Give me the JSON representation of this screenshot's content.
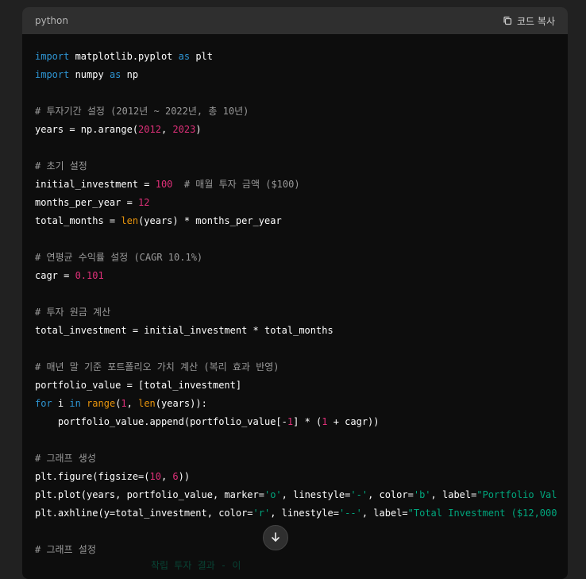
{
  "code_block": {
    "language": "python",
    "copy_label": "코드 복사",
    "lines": [
      [
        {
          "t": "import",
          "c": "kw"
        },
        {
          "t": " matplotlib.pyplot "
        },
        {
          "t": "as",
          "c": "kw"
        },
        {
          "t": " plt"
        }
      ],
      [
        {
          "t": "import",
          "c": "kw"
        },
        {
          "t": " numpy "
        },
        {
          "t": "as",
          "c": "kw"
        },
        {
          "t": " np"
        }
      ],
      [],
      [
        {
          "t": "# 투자기간 설정 (2012년 ~ 2022년, 총 10년)",
          "c": "cm"
        }
      ],
      [
        {
          "t": "years = np.arange("
        },
        {
          "t": "2012",
          "c": "num"
        },
        {
          "t": ", "
        },
        {
          "t": "2023",
          "c": "num"
        },
        {
          "t": ")"
        }
      ],
      [],
      [
        {
          "t": "# 초기 설정",
          "c": "cm"
        }
      ],
      [
        {
          "t": "initial_investment = "
        },
        {
          "t": "100",
          "c": "num"
        },
        {
          "t": "  "
        },
        {
          "t": "# 매월 투자 금액 ($100)",
          "c": "cm"
        }
      ],
      [
        {
          "t": "months_per_year = "
        },
        {
          "t": "12",
          "c": "num"
        }
      ],
      [
        {
          "t": "total_months = "
        },
        {
          "t": "len",
          "c": "bi"
        },
        {
          "t": "(years) * months_per_year"
        }
      ],
      [],
      [
        {
          "t": "# 연평균 수익률 설정 (CAGR 10.1%)",
          "c": "cm"
        }
      ],
      [
        {
          "t": "cagr = "
        },
        {
          "t": "0.101",
          "c": "num"
        }
      ],
      [],
      [
        {
          "t": "# 투자 원금 계산",
          "c": "cm"
        }
      ],
      [
        {
          "t": "total_investment = initial_investment * total_months"
        }
      ],
      [],
      [
        {
          "t": "# 매년 말 기준 포트폴리오 가치 계산 (복리 효과 반영)",
          "c": "cm"
        }
      ],
      [
        {
          "t": "portfolio_value = [total_investment]"
        }
      ],
      [
        {
          "t": "for",
          "c": "kw"
        },
        {
          "t": " i "
        },
        {
          "t": "in",
          "c": "kw"
        },
        {
          "t": " "
        },
        {
          "t": "range",
          "c": "bi"
        },
        {
          "t": "("
        },
        {
          "t": "1",
          "c": "num"
        },
        {
          "t": ", "
        },
        {
          "t": "len",
          "c": "bi"
        },
        {
          "t": "(years)):"
        }
      ],
      [
        {
          "t": "    portfolio_value.append(portfolio_value[-"
        },
        {
          "t": "1",
          "c": "num"
        },
        {
          "t": "] * ("
        },
        {
          "t": "1",
          "c": "num"
        },
        {
          "t": " + cagr))"
        }
      ],
      [],
      [
        {
          "t": "# 그래프 생성",
          "c": "cm"
        }
      ],
      [
        {
          "t": "plt.figure(figsize=("
        },
        {
          "t": "10",
          "c": "num"
        },
        {
          "t": ", "
        },
        {
          "t": "6",
          "c": "num"
        },
        {
          "t": "))"
        }
      ],
      [
        {
          "t": "plt.plot(years, portfolio_value, marker="
        },
        {
          "t": "'o'",
          "c": "str"
        },
        {
          "t": ", linestyle="
        },
        {
          "t": "'-'",
          "c": "str"
        },
        {
          "t": ", color="
        },
        {
          "t": "'b'",
          "c": "str"
        },
        {
          "t": ", label="
        },
        {
          "t": "\"Portfolio Val",
          "c": "str"
        }
      ],
      [
        {
          "t": "plt.axhline(y=total_investment, color="
        },
        {
          "t": "'r'",
          "c": "str"
        },
        {
          "t": ", linestyle="
        },
        {
          "t": "'--'",
          "c": "str"
        },
        {
          "t": ", label="
        },
        {
          "t": "\"Total Investment ($12,000",
          "c": "str"
        }
      ],
      [],
      [
        {
          "t": "# 그래프 설정",
          "c": "cm"
        }
      ]
    ],
    "faded_bottom_text": "착립 투자 결과 - 이",
    "icons": {
      "copy": "copy-icon",
      "scroll": "arrow-down-icon"
    }
  }
}
